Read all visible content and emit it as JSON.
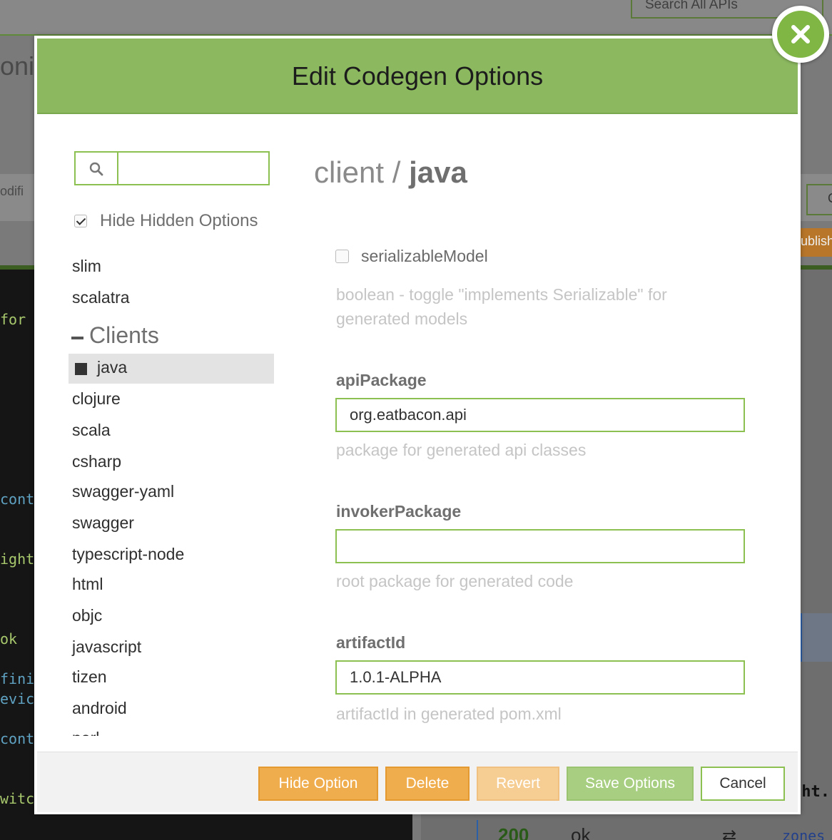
{
  "background": {
    "search_placeholder": "Search All APIs",
    "title_fragment": "oni",
    "modified_fragment": "odifi",
    "right_button_fragment": "C",
    "publish_fragment": "ublish",
    "code_lines": [
      "for",
      "conti",
      "ight",
      "ok",
      "fini",
      "evic",
      "conti",
      "witc"
    ],
    "response_code": "200",
    "response_text": "ok",
    "zones_fragment": "zones",
    "ght_fragment": "ght."
  },
  "modal": {
    "title": "Edit Codegen Options",
    "close_label": "close"
  },
  "sidebar": {
    "search_value": "",
    "hide_hidden_label": "Hide Hidden Options",
    "hide_hidden_checked": true,
    "items_above": [
      "slim",
      "scalatra"
    ],
    "group_label": "Clients",
    "active_item": "java",
    "items_below": [
      "clojure",
      "scala",
      "csharp",
      "swagger-yaml",
      "swagger",
      "typescript-node",
      "html",
      "objc",
      "javascript",
      "tizen",
      "android",
      "perl"
    ]
  },
  "content": {
    "breadcrumb_type": "client /",
    "breadcrumb_name": "java",
    "serializable": {
      "label": "serializableModel",
      "checked": false,
      "desc_line1": "boolean - toggle \"implements Serializable\" for",
      "desc_line2": "generated models"
    },
    "api_package": {
      "label": "apiPackage",
      "value": "org.eatbacon.api",
      "desc": "package for generated api classes"
    },
    "invoker_package": {
      "label": "invokerPackage",
      "value": "",
      "desc": "root package for generated code"
    },
    "artifact_id": {
      "label": "artifactId",
      "value": "1.0.1-ALPHA",
      "desc": "artifactId in generated pom.xml"
    }
  },
  "footer": {
    "hide_option": "Hide Option",
    "delete": "Delete",
    "revert": "Revert",
    "save_options": "Save Options",
    "cancel": "Cancel"
  },
  "colors": {
    "header_green": "#8cb960",
    "accent_green": "#8cc152",
    "orange": "#f0ad4e",
    "close_green": "#7fb644"
  }
}
